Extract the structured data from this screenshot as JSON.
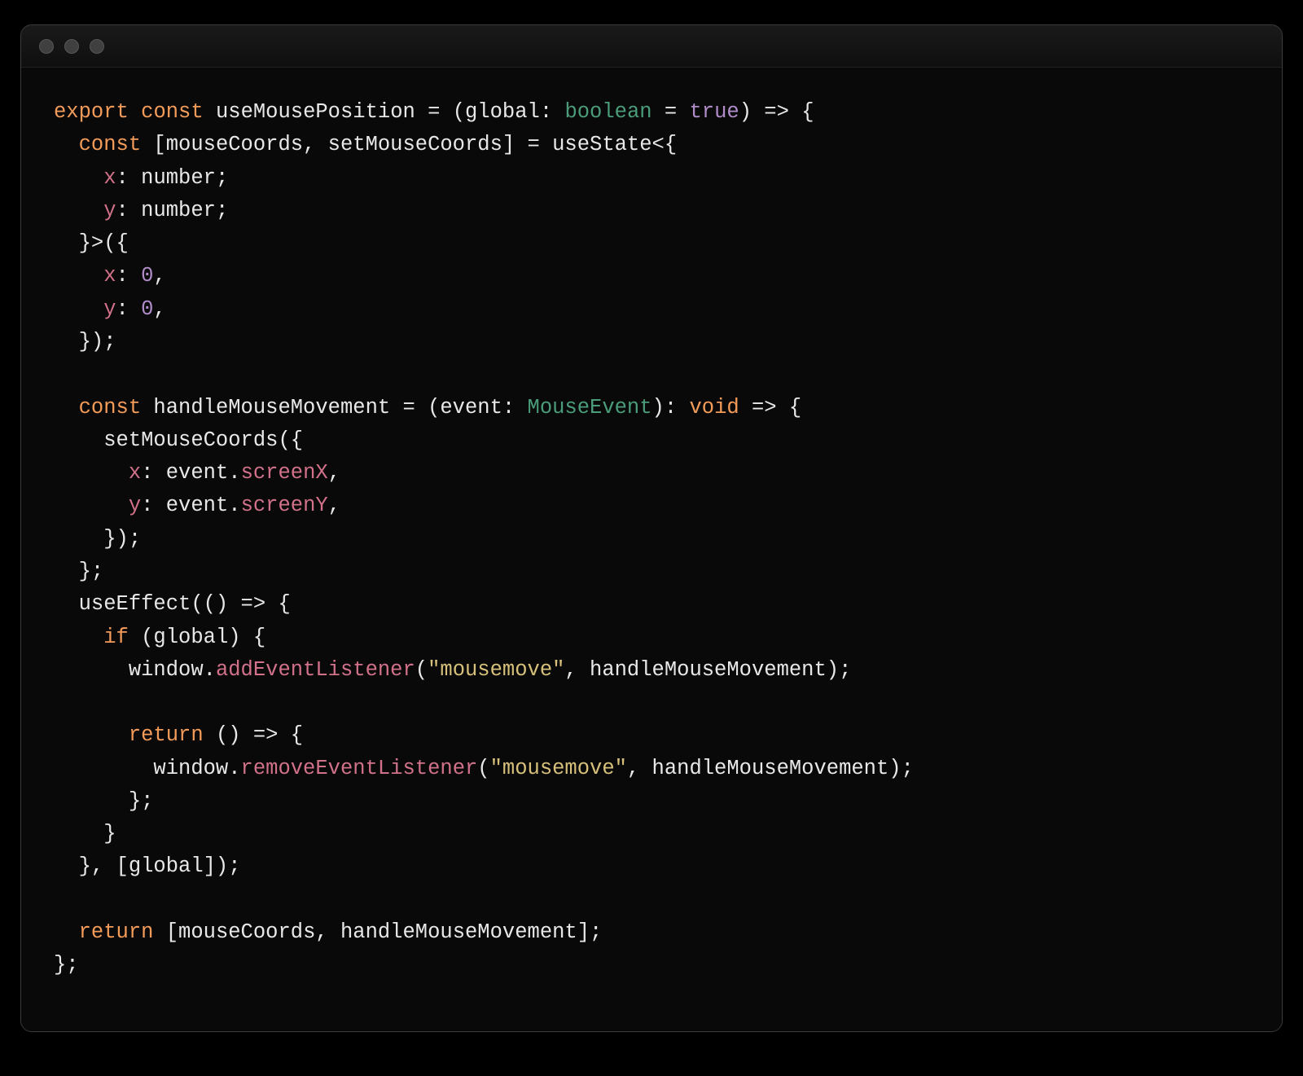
{
  "traffic_lights": [
    "close",
    "minimize",
    "zoom"
  ],
  "code": {
    "tokens": [
      {
        "c": "kw",
        "t": "export"
      },
      {
        "c": "punc",
        "t": " "
      },
      {
        "c": "kw",
        "t": "const"
      },
      {
        "c": "punc",
        "t": " useMousePosition = (global: "
      },
      {
        "c": "type",
        "t": "boolean"
      },
      {
        "c": "punc",
        "t": " = "
      },
      {
        "c": "bool",
        "t": "true"
      },
      {
        "c": "punc",
        "t": ") => {\n"
      },
      {
        "c": "punc",
        "t": "  "
      },
      {
        "c": "kw",
        "t": "const"
      },
      {
        "c": "punc",
        "t": " [mouseCoords, setMouseCoords] = useState<{\n"
      },
      {
        "c": "punc",
        "t": "    "
      },
      {
        "c": "prop",
        "t": "x"
      },
      {
        "c": "punc",
        "t": ": number;\n"
      },
      {
        "c": "punc",
        "t": "    "
      },
      {
        "c": "prop",
        "t": "y"
      },
      {
        "c": "punc",
        "t": ": number;\n"
      },
      {
        "c": "punc",
        "t": "  }>({\n"
      },
      {
        "c": "punc",
        "t": "    "
      },
      {
        "c": "prop",
        "t": "x"
      },
      {
        "c": "punc",
        "t": ": "
      },
      {
        "c": "num",
        "t": "0"
      },
      {
        "c": "punc",
        "t": ",\n"
      },
      {
        "c": "punc",
        "t": "    "
      },
      {
        "c": "prop",
        "t": "y"
      },
      {
        "c": "punc",
        "t": ": "
      },
      {
        "c": "num",
        "t": "0"
      },
      {
        "c": "punc",
        "t": ",\n"
      },
      {
        "c": "punc",
        "t": "  });\n"
      },
      {
        "c": "punc",
        "t": "\n"
      },
      {
        "c": "punc",
        "t": "  "
      },
      {
        "c": "kw",
        "t": "const"
      },
      {
        "c": "punc",
        "t": " handleMouseMovement = (event: "
      },
      {
        "c": "type",
        "t": "MouseEvent"
      },
      {
        "c": "punc",
        "t": "): "
      },
      {
        "c": "kw",
        "t": "void"
      },
      {
        "c": "punc",
        "t": " => {\n"
      },
      {
        "c": "punc",
        "t": "    setMouseCoords({\n"
      },
      {
        "c": "punc",
        "t": "      "
      },
      {
        "c": "prop",
        "t": "x"
      },
      {
        "c": "punc",
        "t": ": event."
      },
      {
        "c": "prop",
        "t": "screenX"
      },
      {
        "c": "punc",
        "t": ",\n"
      },
      {
        "c": "punc",
        "t": "      "
      },
      {
        "c": "prop",
        "t": "y"
      },
      {
        "c": "punc",
        "t": ": event."
      },
      {
        "c": "prop",
        "t": "screenY"
      },
      {
        "c": "punc",
        "t": ",\n"
      },
      {
        "c": "punc",
        "t": "    });\n"
      },
      {
        "c": "punc",
        "t": "  };\n"
      },
      {
        "c": "punc",
        "t": "  useEffect(() => {\n"
      },
      {
        "c": "punc",
        "t": "    "
      },
      {
        "c": "kw",
        "t": "if"
      },
      {
        "c": "punc",
        "t": " (global) {\n"
      },
      {
        "c": "punc",
        "t": "      window."
      },
      {
        "c": "prop",
        "t": "addEventListener"
      },
      {
        "c": "punc",
        "t": "("
      },
      {
        "c": "str",
        "t": "\"mousemove\""
      },
      {
        "c": "punc",
        "t": ", handleMouseMovement);\n"
      },
      {
        "c": "punc",
        "t": "\n"
      },
      {
        "c": "punc",
        "t": "      "
      },
      {
        "c": "kw",
        "t": "return"
      },
      {
        "c": "punc",
        "t": " () => {\n"
      },
      {
        "c": "punc",
        "t": "        window."
      },
      {
        "c": "prop",
        "t": "removeEventListener"
      },
      {
        "c": "punc",
        "t": "("
      },
      {
        "c": "str",
        "t": "\"mousemove\""
      },
      {
        "c": "punc",
        "t": ", handleMouseMovement);\n"
      },
      {
        "c": "punc",
        "t": "      };\n"
      },
      {
        "c": "punc",
        "t": "    }\n"
      },
      {
        "c": "punc",
        "t": "  }, [global]);\n"
      },
      {
        "c": "punc",
        "t": "\n"
      },
      {
        "c": "punc",
        "t": "  "
      },
      {
        "c": "kw",
        "t": "return"
      },
      {
        "c": "punc",
        "t": " [mouseCoords, handleMouseMovement];\n"
      },
      {
        "c": "punc",
        "t": "};"
      }
    ]
  }
}
